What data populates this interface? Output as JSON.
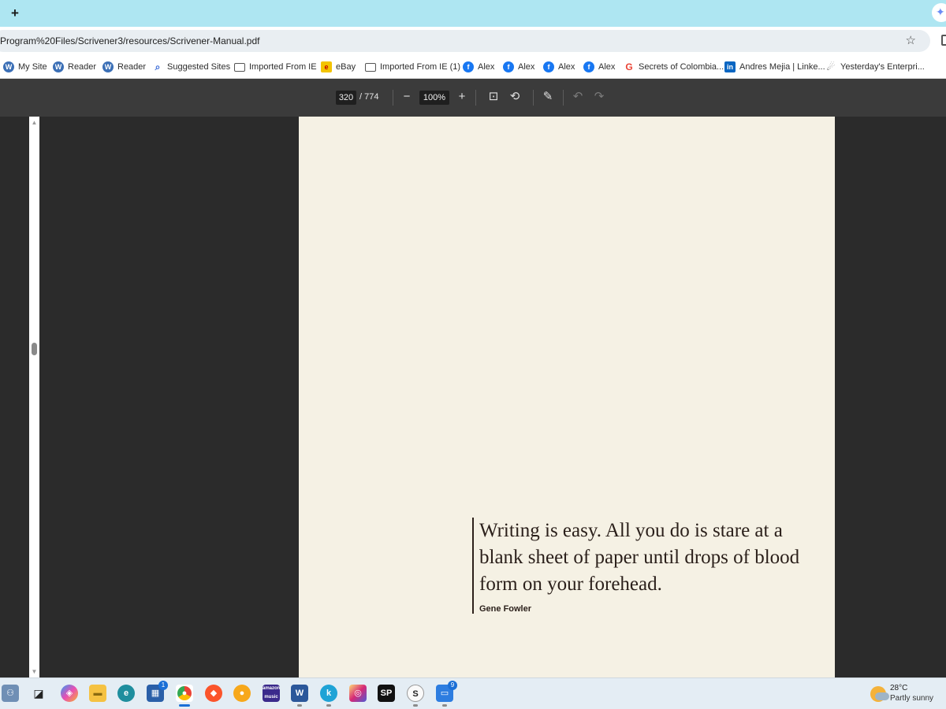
{
  "browser": {
    "new_tab_icon": "+",
    "url": "Program%20Files/Scrivener3/resources/Scrivener-Manual.pdf",
    "bookmark_star": "☆"
  },
  "bookmarks": [
    {
      "label": "My Site",
      "icon": "wordpress-icon"
    },
    {
      "label": "Reader",
      "icon": "wordpress-icon"
    },
    {
      "label": "Reader",
      "icon": "wordpress-icon"
    },
    {
      "label": "Suggested Sites",
      "icon": "search-icon"
    },
    {
      "label": "Imported From IE",
      "icon": "folder-icon"
    },
    {
      "label": "eBay",
      "icon": "ebay-icon"
    },
    {
      "label": "Imported From IE (1)",
      "icon": "folder-icon"
    },
    {
      "label": "Alex",
      "icon": "facebook-icon"
    },
    {
      "label": "Alex",
      "icon": "facebook-icon"
    },
    {
      "label": "Alex",
      "icon": "facebook-icon"
    },
    {
      "label": "Alex",
      "icon": "facebook-icon"
    },
    {
      "label": "Secrets of Colombia...",
      "icon": "google-icon"
    },
    {
      "label": "Andres Mejia | Linke...",
      "icon": "linkedin-icon"
    },
    {
      "label": "Yesterday's Enterpri...",
      "icon": "site-icon"
    }
  ],
  "pdf_toolbar": {
    "current_page": "320",
    "total_pages": "/ 774",
    "zoom": "100%",
    "zoom_out": "−",
    "zoom_in": "+"
  },
  "document": {
    "quote": "Writing is easy. All you do is stare at a blank sheet of paper until drops of blood form on your forehead.",
    "author": "Gene Fowler",
    "page_color": "#f5f1e4"
  },
  "taskbar": {
    "store_badge": "1",
    "word_badge": "9",
    "weather_temp": "28°C",
    "weather_condition": "Partly sunny"
  },
  "colors": {
    "tabstrip": "#aee6f2",
    "pdf_toolbar": "#3b3b3b",
    "viewer_bg": "#2b2b2b"
  }
}
